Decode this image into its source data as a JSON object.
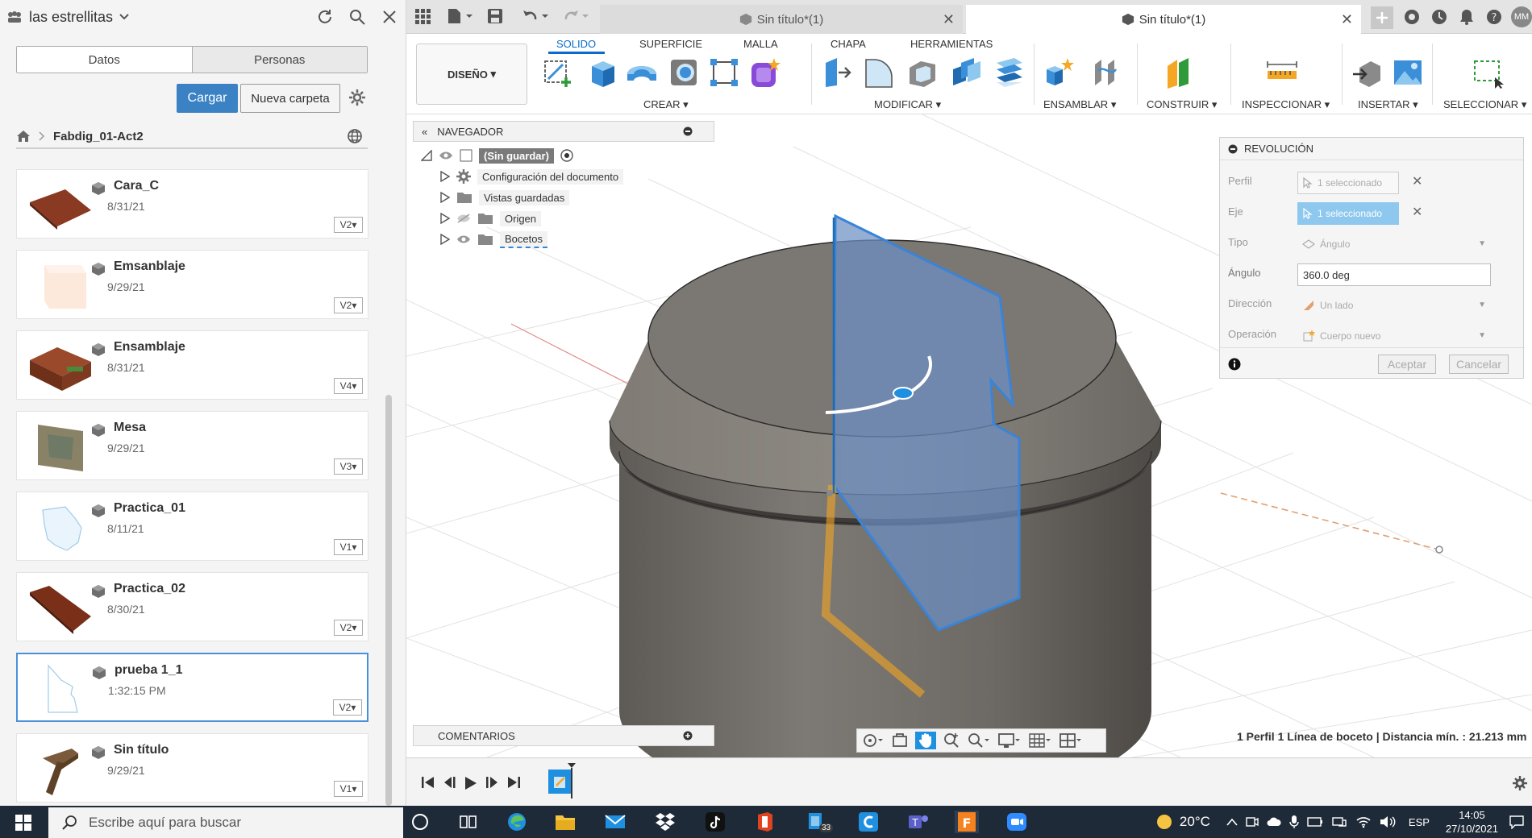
{
  "data_panel": {
    "team": "las estrellitas",
    "tabs": [
      "Datos",
      "Personas"
    ],
    "upload_label": "Cargar",
    "new_folder_label": "Nueva carpeta",
    "project": "Fabdig_01-Act2",
    "files": [
      {
        "name": "Cara_C",
        "date": "8/31/21",
        "version": "V2"
      },
      {
        "name": "Emsanblaje",
        "date": "9/29/21",
        "version": "V2"
      },
      {
        "name": "Ensamblaje",
        "date": "8/31/21",
        "version": "V4"
      },
      {
        "name": "Mesa",
        "date": "9/29/21",
        "version": "V3"
      },
      {
        "name": "Practica_01",
        "date": "8/11/21",
        "version": "V1"
      },
      {
        "name": "Practica_02",
        "date": "8/30/21",
        "version": "V2"
      },
      {
        "name": "prueba 1_1",
        "date": "1:32:15 PM",
        "version": "V2"
      },
      {
        "name": "Sin título",
        "date": "9/29/21",
        "version": "V1"
      }
    ]
  },
  "tabs": [
    {
      "label": "Sin título*(1)"
    },
    {
      "label": "Sin título*(1)"
    }
  ],
  "user_initials": "MM",
  "toolbar": {
    "workspace": "DISEÑO",
    "ribbon_tabs": [
      "SOLIDO",
      "SUPERFICIE",
      "MALLA",
      "CHAPA",
      "HERRAMIENTAS"
    ],
    "groups": [
      "CREAR",
      "MODIFICAR",
      "ENSAMBLAR",
      "CONSTRUIR",
      "INSPECCIONAR",
      "INSERTAR",
      "SELECCIONAR"
    ]
  },
  "browser": {
    "title": "NAVEGADOR",
    "root": "(Sin guardar)",
    "items": [
      "Configuración del documento",
      "Vistas guardadas",
      "Origen",
      "Bocetos"
    ]
  },
  "revolve": {
    "title": "REVOLUCIÓN",
    "profile_label": "Perfil",
    "profile_value": "1 seleccionado",
    "axis_label": "Eje",
    "axis_value": "1 seleccionado",
    "type_label": "Tipo",
    "type_value": "Ángulo",
    "angle_label": "Ángulo",
    "angle_value": "360.0 deg",
    "direction_label": "Dirección",
    "direction_value": "Un lado",
    "operation_label": "Operación",
    "operation_value": "Cuerpo nuevo",
    "ok_label": "Aceptar",
    "cancel_label": "Cancelar"
  },
  "comments": "COMENTARIOS",
  "status": "1 Perfil 1 Línea de boceto | Distancia mín. : 21.213 mm",
  "taskbar": {
    "search_placeholder": "Escribe aquí para buscar",
    "badge": "33",
    "temperature": "20°C",
    "language": "ESP",
    "time": "14:05",
    "date": "27/10/2021"
  },
  "colors": {
    "accent": "#0b6bcb",
    "upload_button": "#3b82c4",
    "selection": "#8ec8ee",
    "body": "#7a7772",
    "profile_fill": "#6c8fc4"
  }
}
